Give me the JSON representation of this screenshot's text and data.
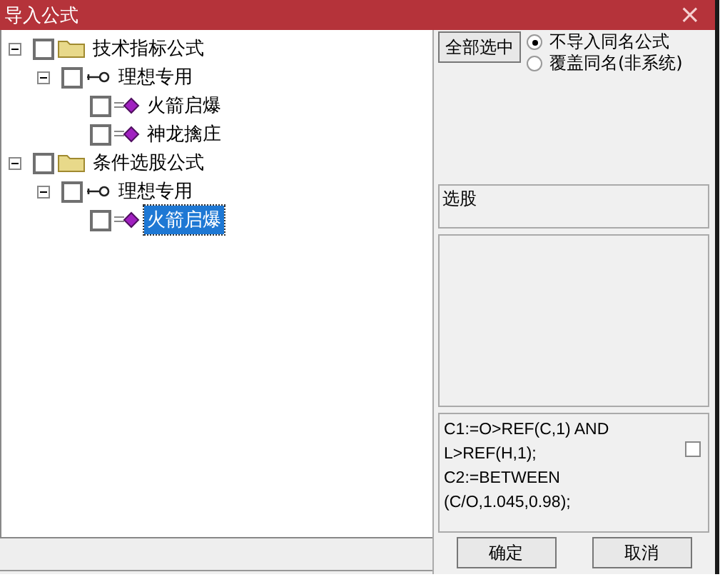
{
  "window": {
    "title": "导入公式",
    "close": "×"
  },
  "tree": [
    {
      "label": "技术指标公式",
      "kind": "folder",
      "checked": false,
      "expanded": true,
      "selected": false,
      "children": [
        {
          "label": "理想专用",
          "kind": "group",
          "checked": false,
          "expanded": true,
          "selected": false,
          "children": [
            {
              "label": "火箭启爆",
              "kind": "formula",
              "checked": false,
              "selected": false
            },
            {
              "label": "神龙擒庄",
              "kind": "formula",
              "checked": false,
              "selected": false
            }
          ]
        }
      ]
    },
    {
      "label": "条件选股公式",
      "kind": "folder",
      "checked": false,
      "expanded": true,
      "selected": false,
      "children": [
        {
          "label": "理想专用",
          "kind": "group",
          "checked": false,
          "expanded": true,
          "selected": false,
          "children": [
            {
              "label": "火箭启爆",
              "kind": "formula",
              "checked": false,
              "selected": true
            }
          ]
        }
      ]
    }
  ],
  "select_all_button": "全部选中",
  "options": [
    {
      "label": "不导入同名公式",
      "selected": true
    },
    {
      "label": "覆盖同名(非系统)",
      "selected": false
    }
  ],
  "category_field": {
    "value": "选股"
  },
  "formula_text": "C1:=O>REF(C,1) AND L>REF(H,1);\nC2:=BETWEEN (C/O,1.045,0.98);",
  "formula_checkbox": {
    "checked": false
  },
  "buttons": [
    "确定",
    "取消"
  ]
}
